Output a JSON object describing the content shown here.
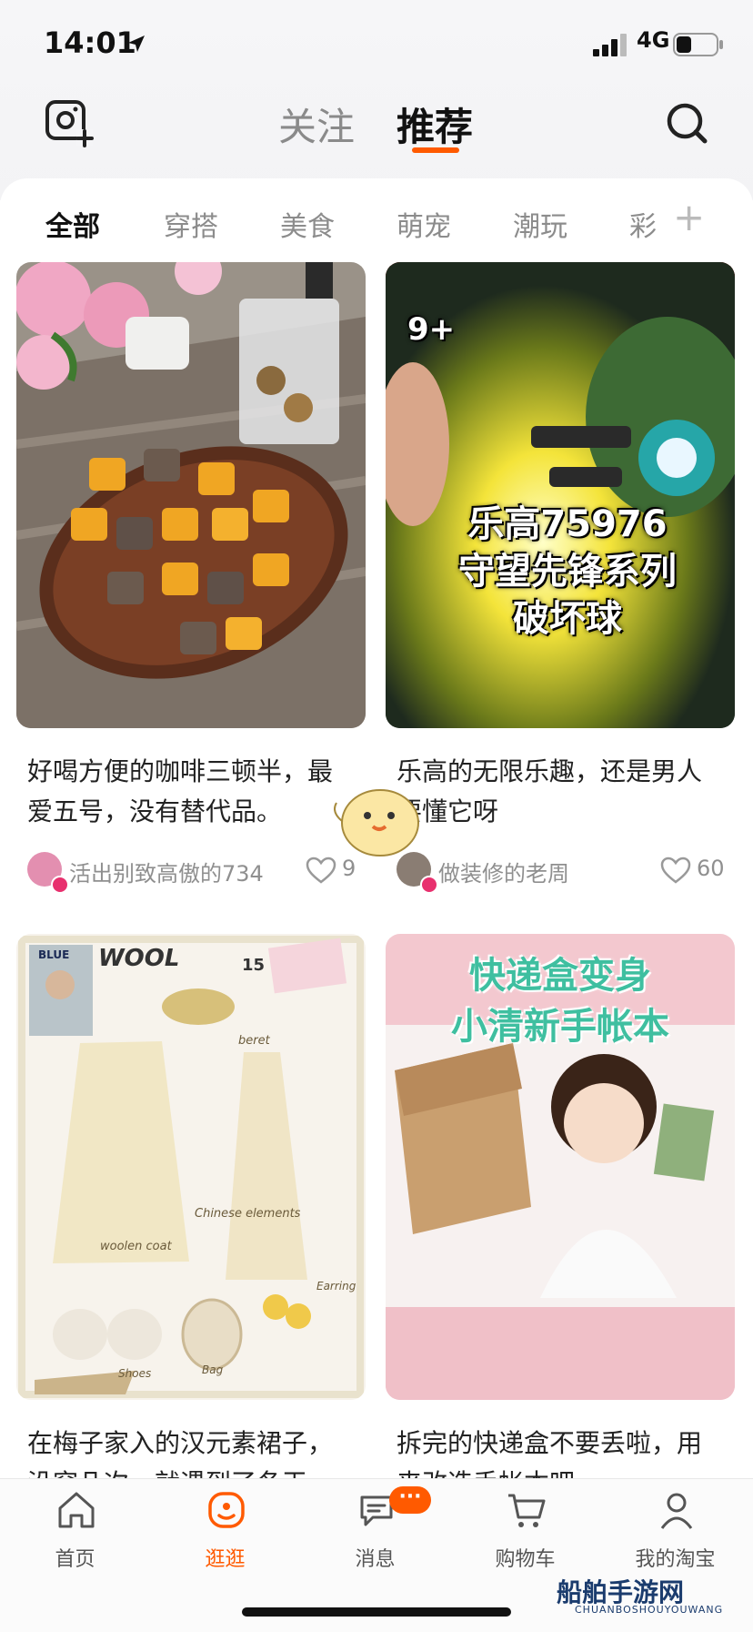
{
  "status_bar": {
    "time": "14:01",
    "network": "4G"
  },
  "top_nav": {
    "tabs": [
      {
        "label": "关注"
      },
      {
        "label": "推荐"
      }
    ]
  },
  "categories": [
    "全部",
    "穿搭",
    "美食",
    "萌宠",
    "潮玩",
    "彩"
  ],
  "category_add": "+",
  "cards": [
    {
      "title": "好喝方便的咖啡三顿半，最爱五号，没有替代品。",
      "author": "活出别致高傲的734",
      "likes": "9",
      "image_label": ""
    },
    {
      "title": "乐高的无限乐趣，还是男人要懂它呀",
      "author": "做装修的老周",
      "likes": "60",
      "image_label": "乐高75976\n守望先锋系列\n破坏球",
      "box_text": "9+",
      "box_code": "75976"
    },
    {
      "title": "在梅子家入的汉元素裙子，没穿几次，就遇到了冬天",
      "image_text": {
        "heading": "WOOL",
        "num": "15",
        "beret": "beret",
        "coat": "woolen coat",
        "elements": "Chinese elements",
        "shoes": "Shoes",
        "bag": "Bag",
        "earring": "Earring",
        "blue": "BLUE"
      }
    },
    {
      "title": "拆完的快递盒不要丢啦，用来改造手帐本吧",
      "image_label": "快递盒变身\n小清新手帐本"
    }
  ],
  "tab_bar": {
    "tabs": [
      {
        "label": "首页"
      },
      {
        "label": "逛逛"
      },
      {
        "label": "消息"
      },
      {
        "label": "购物车"
      },
      {
        "label": "我的淘宝"
      }
    ],
    "message_badge": "···"
  },
  "watermark": {
    "main": "船舶手游网",
    "sub": "CHUANBOSHOUYOUWANG"
  },
  "colors": {
    "accent": "#ff5a00",
    "text": "#222222",
    "muted": "#8f8f8f"
  }
}
